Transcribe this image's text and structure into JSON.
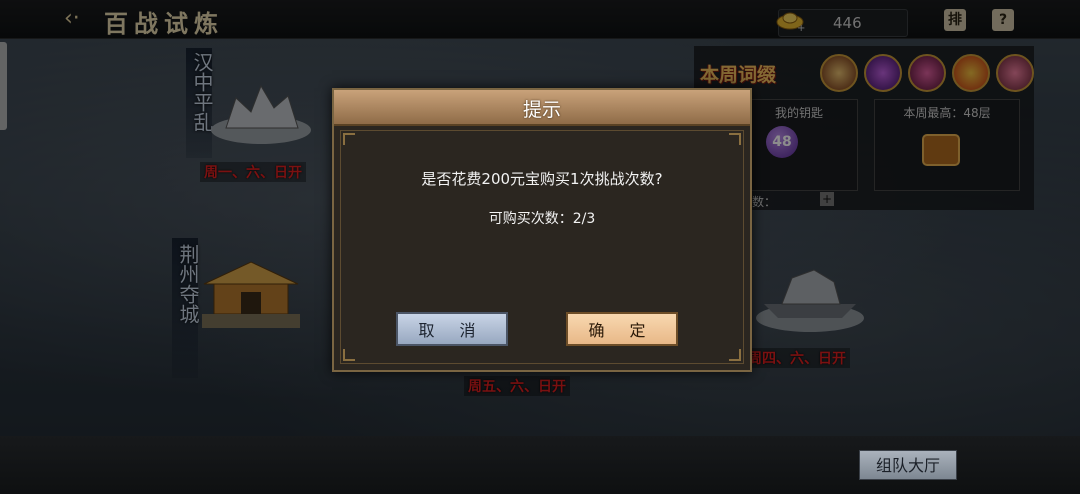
{
  "header": {
    "title": "百战试炼",
    "currency_value": "446",
    "rank_label": "排",
    "help_label": "?"
  },
  "stages": [
    {
      "name": "汉中平乱",
      "days": "周一、六、日开"
    },
    {
      "name": "荆州夺城",
      "days": ""
    },
    {
      "name": "",
      "days": "周五、六、日开"
    },
    {
      "name": "",
      "days": "周四、六、日开"
    }
  ],
  "weekly": {
    "title": "本周词缀",
    "my_keys_label": "我的钥匙",
    "keys_count": "48",
    "best_label": "本周最高：48层",
    "times_label": "次数："
  },
  "dialog": {
    "title": "提示",
    "message": "是否花费200元宝购买1次挑战次数?",
    "remaining": "可购买次数：2/3",
    "cancel_label": "取 消",
    "confirm_label": "确 定"
  },
  "footer": {
    "lobby_label": "组队大厅"
  },
  "colors": {
    "accent": "#c89a3a",
    "stage_days": "#e02020"
  }
}
